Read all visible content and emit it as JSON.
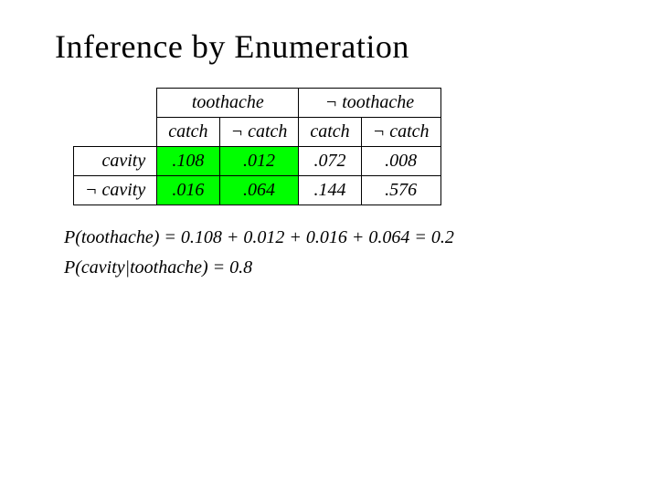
{
  "title": "Inference by Enumeration",
  "table": {
    "header_row1": {
      "empty1": "",
      "toothache": "toothache",
      "neg_toothache": "¬ toothache"
    },
    "header_row2": {
      "empty2": "",
      "catch1": "catch",
      "neg_catch1": "¬ catch",
      "catch2": "catch",
      "neg_catch2": "¬ catch"
    },
    "data_rows": [
      {
        "label": "cavity",
        "v1": ".108",
        "v2": ".012",
        "v3": ".072",
        "v4": ".008"
      },
      {
        "label": "¬ cavity",
        "v1": ".016",
        "v2": ".064",
        "v3": ".144",
        "v4": ".576"
      }
    ]
  },
  "formulas": [
    "P(toothache) = 0.108 + 0.012 + 0.016 + 0.064 = 0.2",
    "P(cavity|toothache) = 0.8"
  ]
}
